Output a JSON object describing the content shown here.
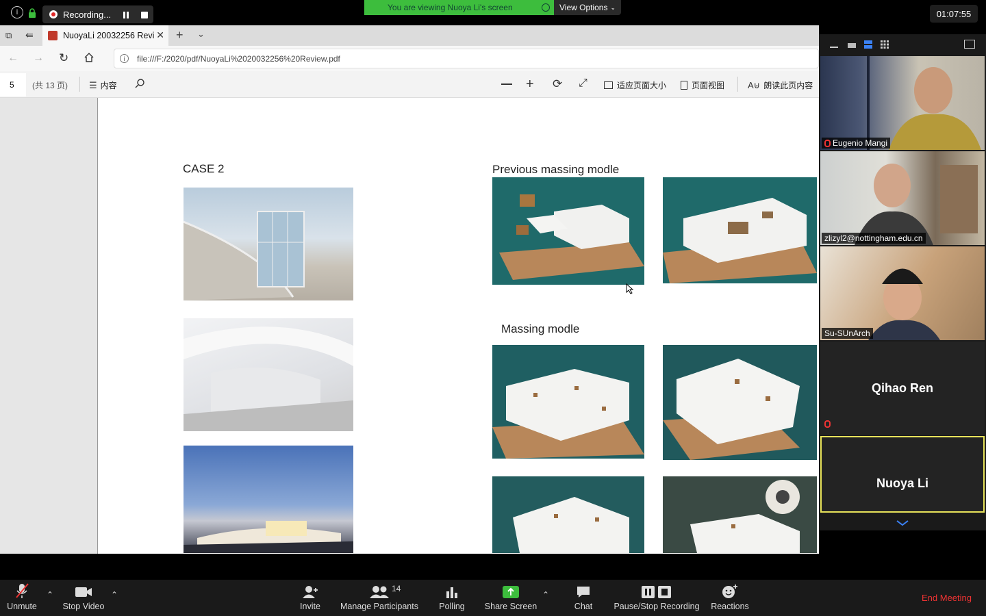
{
  "zoom_top": {
    "recording_label": "Recording...",
    "viewing_banner": "You are viewing Nuoya Li's screen",
    "view_options": "View Options",
    "clock": "01:07:55"
  },
  "browser": {
    "tab_title": "NuoyaLi 20032256 Revi",
    "url": "file:///F:/2020/pdf/NuoyaLi%2020032256%20Review.pdf"
  },
  "pdf_toolbar": {
    "page_number": "5",
    "page_total": "(共 13 页)",
    "contents": "内容",
    "fit_page": "适应页面大小",
    "page_view": "页面视图",
    "read_aloud": "朗读此页内容"
  },
  "document": {
    "case_title": "CASE 2",
    "previous_title": "Previous massing modle",
    "massing_title": "Massing modle"
  },
  "participants": [
    {
      "name": "Eugenio Mangi",
      "muted": true
    },
    {
      "name": "zlizyl2@nottingham.edu.cn",
      "muted": false
    },
    {
      "name": "Su-SUnArch",
      "muted": false
    },
    {
      "name": "Qihao Ren",
      "muted": true
    },
    {
      "name": "Nuoya Li",
      "muted": false
    }
  ],
  "bottom_bar": {
    "unmute": "Unmute",
    "stop_video": "Stop Video",
    "invite": "Invite",
    "manage_participants": "Manage Participants",
    "participant_count": "14",
    "polling": "Polling",
    "share_screen": "Share Screen",
    "chat": "Chat",
    "pause_stop_recording": "Pause/Stop Recording",
    "reactions": "Reactions",
    "end_meeting": "End Meeting"
  },
  "colors": {
    "share_green": "#3dbd3d",
    "end_red": "#e33333",
    "active_speaker": "#e8e35a"
  }
}
